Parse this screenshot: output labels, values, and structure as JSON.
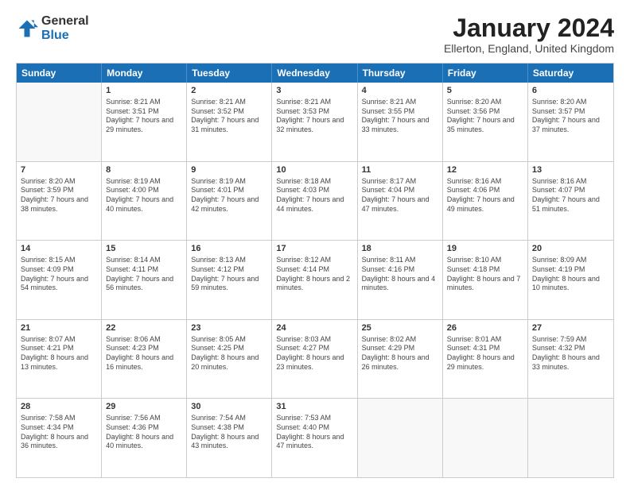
{
  "logo": {
    "general": "General",
    "blue": "Blue"
  },
  "title": "January 2024",
  "location": "Ellerton, England, United Kingdom",
  "days_of_week": [
    "Sunday",
    "Monday",
    "Tuesday",
    "Wednesday",
    "Thursday",
    "Friday",
    "Saturday"
  ],
  "weeks": [
    [
      {
        "day": "",
        "sunrise": "",
        "sunset": "",
        "daylight": ""
      },
      {
        "day": "1",
        "sunrise": "Sunrise: 8:21 AM",
        "sunset": "Sunset: 3:51 PM",
        "daylight": "Daylight: 7 hours and 29 minutes."
      },
      {
        "day": "2",
        "sunrise": "Sunrise: 8:21 AM",
        "sunset": "Sunset: 3:52 PM",
        "daylight": "Daylight: 7 hours and 31 minutes."
      },
      {
        "day": "3",
        "sunrise": "Sunrise: 8:21 AM",
        "sunset": "Sunset: 3:53 PM",
        "daylight": "Daylight: 7 hours and 32 minutes."
      },
      {
        "day": "4",
        "sunrise": "Sunrise: 8:21 AM",
        "sunset": "Sunset: 3:55 PM",
        "daylight": "Daylight: 7 hours and 33 minutes."
      },
      {
        "day": "5",
        "sunrise": "Sunrise: 8:20 AM",
        "sunset": "Sunset: 3:56 PM",
        "daylight": "Daylight: 7 hours and 35 minutes."
      },
      {
        "day": "6",
        "sunrise": "Sunrise: 8:20 AM",
        "sunset": "Sunset: 3:57 PM",
        "daylight": "Daylight: 7 hours and 37 minutes."
      }
    ],
    [
      {
        "day": "7",
        "sunrise": "Sunrise: 8:20 AM",
        "sunset": "Sunset: 3:59 PM",
        "daylight": "Daylight: 7 hours and 38 minutes."
      },
      {
        "day": "8",
        "sunrise": "Sunrise: 8:19 AM",
        "sunset": "Sunset: 4:00 PM",
        "daylight": "Daylight: 7 hours and 40 minutes."
      },
      {
        "day": "9",
        "sunrise": "Sunrise: 8:19 AM",
        "sunset": "Sunset: 4:01 PM",
        "daylight": "Daylight: 7 hours and 42 minutes."
      },
      {
        "day": "10",
        "sunrise": "Sunrise: 8:18 AM",
        "sunset": "Sunset: 4:03 PM",
        "daylight": "Daylight: 7 hours and 44 minutes."
      },
      {
        "day": "11",
        "sunrise": "Sunrise: 8:17 AM",
        "sunset": "Sunset: 4:04 PM",
        "daylight": "Daylight: 7 hours and 47 minutes."
      },
      {
        "day": "12",
        "sunrise": "Sunrise: 8:16 AM",
        "sunset": "Sunset: 4:06 PM",
        "daylight": "Daylight: 7 hours and 49 minutes."
      },
      {
        "day": "13",
        "sunrise": "Sunrise: 8:16 AM",
        "sunset": "Sunset: 4:07 PM",
        "daylight": "Daylight: 7 hours and 51 minutes."
      }
    ],
    [
      {
        "day": "14",
        "sunrise": "Sunrise: 8:15 AM",
        "sunset": "Sunset: 4:09 PM",
        "daylight": "Daylight: 7 hours and 54 minutes."
      },
      {
        "day": "15",
        "sunrise": "Sunrise: 8:14 AM",
        "sunset": "Sunset: 4:11 PM",
        "daylight": "Daylight: 7 hours and 56 minutes."
      },
      {
        "day": "16",
        "sunrise": "Sunrise: 8:13 AM",
        "sunset": "Sunset: 4:12 PM",
        "daylight": "Daylight: 7 hours and 59 minutes."
      },
      {
        "day": "17",
        "sunrise": "Sunrise: 8:12 AM",
        "sunset": "Sunset: 4:14 PM",
        "daylight": "Daylight: 8 hours and 2 minutes."
      },
      {
        "day": "18",
        "sunrise": "Sunrise: 8:11 AM",
        "sunset": "Sunset: 4:16 PM",
        "daylight": "Daylight: 8 hours and 4 minutes."
      },
      {
        "day": "19",
        "sunrise": "Sunrise: 8:10 AM",
        "sunset": "Sunset: 4:18 PM",
        "daylight": "Daylight: 8 hours and 7 minutes."
      },
      {
        "day": "20",
        "sunrise": "Sunrise: 8:09 AM",
        "sunset": "Sunset: 4:19 PM",
        "daylight": "Daylight: 8 hours and 10 minutes."
      }
    ],
    [
      {
        "day": "21",
        "sunrise": "Sunrise: 8:07 AM",
        "sunset": "Sunset: 4:21 PM",
        "daylight": "Daylight: 8 hours and 13 minutes."
      },
      {
        "day": "22",
        "sunrise": "Sunrise: 8:06 AM",
        "sunset": "Sunset: 4:23 PM",
        "daylight": "Daylight: 8 hours and 16 minutes."
      },
      {
        "day": "23",
        "sunrise": "Sunrise: 8:05 AM",
        "sunset": "Sunset: 4:25 PM",
        "daylight": "Daylight: 8 hours and 20 minutes."
      },
      {
        "day": "24",
        "sunrise": "Sunrise: 8:03 AM",
        "sunset": "Sunset: 4:27 PM",
        "daylight": "Daylight: 8 hours and 23 minutes."
      },
      {
        "day": "25",
        "sunrise": "Sunrise: 8:02 AM",
        "sunset": "Sunset: 4:29 PM",
        "daylight": "Daylight: 8 hours and 26 minutes."
      },
      {
        "day": "26",
        "sunrise": "Sunrise: 8:01 AM",
        "sunset": "Sunset: 4:31 PM",
        "daylight": "Daylight: 8 hours and 29 minutes."
      },
      {
        "day": "27",
        "sunrise": "Sunrise: 7:59 AM",
        "sunset": "Sunset: 4:32 PM",
        "daylight": "Daylight: 8 hours and 33 minutes."
      }
    ],
    [
      {
        "day": "28",
        "sunrise": "Sunrise: 7:58 AM",
        "sunset": "Sunset: 4:34 PM",
        "daylight": "Daylight: 8 hours and 36 minutes."
      },
      {
        "day": "29",
        "sunrise": "Sunrise: 7:56 AM",
        "sunset": "Sunset: 4:36 PM",
        "daylight": "Daylight: 8 hours and 40 minutes."
      },
      {
        "day": "30",
        "sunrise": "Sunrise: 7:54 AM",
        "sunset": "Sunset: 4:38 PM",
        "daylight": "Daylight: 8 hours and 43 minutes."
      },
      {
        "day": "31",
        "sunrise": "Sunrise: 7:53 AM",
        "sunset": "Sunset: 4:40 PM",
        "daylight": "Daylight: 8 hours and 47 minutes."
      },
      {
        "day": "",
        "sunrise": "",
        "sunset": "",
        "daylight": ""
      },
      {
        "day": "",
        "sunrise": "",
        "sunset": "",
        "daylight": ""
      },
      {
        "day": "",
        "sunrise": "",
        "sunset": "",
        "daylight": ""
      }
    ]
  ]
}
